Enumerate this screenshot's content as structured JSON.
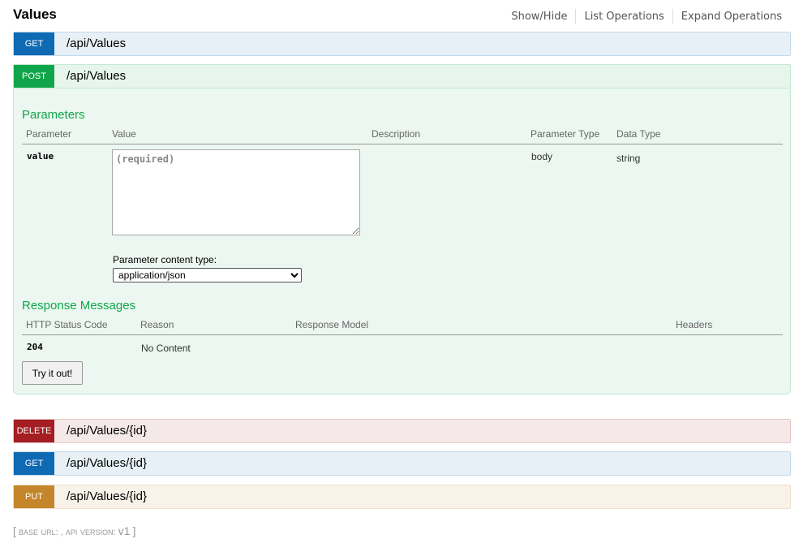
{
  "resource": {
    "title": "Values",
    "options": [
      "Show/Hide",
      "List Operations",
      "Expand Operations"
    ]
  },
  "operations": [
    {
      "verb": "GET",
      "path": "/api/Values"
    },
    {
      "verb": "POST",
      "path": "/api/Values"
    },
    {
      "verb": "DELETE",
      "path": "/api/Values/{id}"
    },
    {
      "verb": "GET",
      "path": "/api/Values/{id}"
    },
    {
      "verb": "PUT",
      "path": "/api/Values/{id}"
    }
  ],
  "post": {
    "parameters_title": "Parameters",
    "param_headers": [
      "Parameter",
      "Value",
      "Description",
      "Parameter Type",
      "Data Type"
    ],
    "param": {
      "name": "value",
      "placeholder": "(required)",
      "param_type": "body",
      "data_type": "string"
    },
    "content_type_label": "Parameter content type:",
    "content_type_value": "application/json",
    "responses_title": "Response Messages",
    "response_headers": [
      "HTTP Status Code",
      "Reason",
      "Response Model",
      "Headers"
    ],
    "response": {
      "code": "204",
      "reason": "No Content"
    },
    "try_button": "Try it out!"
  },
  "footer": {
    "bracket_open": "[",
    "base_url_label": "base url",
    "sep1": ": ,",
    "api_version_label": "api version",
    "sep2": ":",
    "version": "v1",
    "bracket_close": "]"
  },
  "colors": {
    "get": "#0f6ab4",
    "post": "#10a54a",
    "delete": "#a41e22",
    "put": "#c5862b"
  }
}
